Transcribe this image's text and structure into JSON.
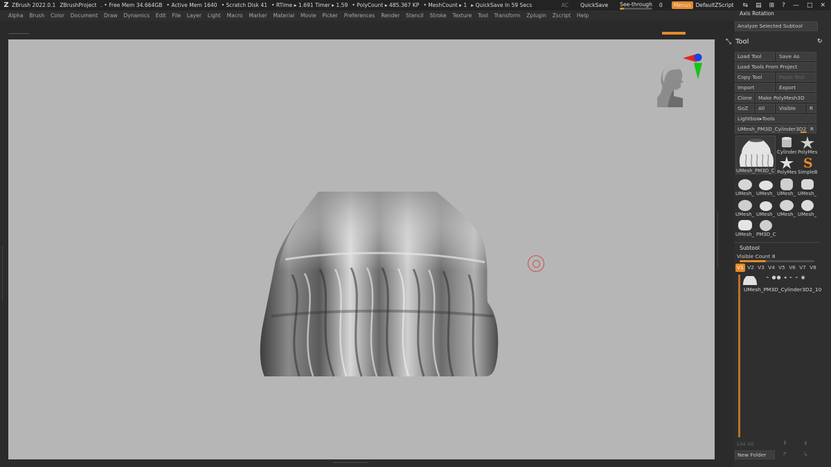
{
  "titlebar": {
    "app": "ZBrush 2022.0.1",
    "project": "ZBrushProject",
    "free_mem": ". • Free Mem 34.664GB",
    "active_mem": "• Active Mem 1640",
    "scratch_disk": "• Scratch Disk 41",
    "rtime": "• RTime ▸ 1.691 Timer ▸ 1.59",
    "polycount": "• PolyCount ▸ 485.367 KP",
    "meshcount": "• MeshCount ▸ 1",
    "quicksave_in": "▸ QuickSave In 59 Secs",
    "ac": "AC",
    "quicksave": "QuickSave",
    "see_through_label": "See-through",
    "see_through_value": "0",
    "see_through_level": 0.12,
    "menus": "Menus",
    "script": "DefaultZScript"
  },
  "menubar": [
    "Alpha",
    "Brush",
    "Color",
    "Document",
    "Draw",
    "Dynamics",
    "Edit",
    "File",
    "Layer",
    "Light",
    "Macro",
    "Marker",
    "Material",
    "Movie",
    "Picker",
    "Preferences",
    "Render",
    "Stencil",
    "Stroke",
    "Texture",
    "Tool",
    "Transform",
    "Zplugin",
    "Zscript",
    "Help"
  ],
  "rpanel": {
    "axis_rotation": "Axis Rotation",
    "analyze": "Analyze Selected Subtool",
    "tool_title": "Tool",
    "buttons": {
      "load_tool": "Load Tool",
      "save_as": "Save As",
      "load_from_project": "Load Tools From Project",
      "copy_tool": "Copy Tool",
      "paste_tool": "Paste Tool",
      "import": "Import",
      "export": "Export",
      "clone": "Clone",
      "make_polymesh": "Make PolyMesh3D",
      "goz": "GoZ",
      "all": "All",
      "visible": "Visible",
      "r": "R",
      "lightbox_tools": "Lightbox▸Tools",
      "current_tool": "UMesh_PM3D_Cylinder3D2_1",
      "current_tool_r": "R"
    },
    "thumbs": {
      "main": "UMesh_PM3D_C",
      "cylinder": "Cylinder",
      "polymesh_1": "PolyMes",
      "polymesh_2": "PolyMes",
      "simple": "SimpleB",
      "minis": [
        "UMesh_",
        "UMesh_",
        "UMesh_",
        "UMesh_",
        "UMesh_",
        "UMesh_",
        "UMesh_",
        "UMesh_",
        "UMesh_",
        "PM3D_C"
      ]
    },
    "subtool": {
      "title": "Subtool",
      "visible_count": "Visible Count 8",
      "visible_count_level": 0.35,
      "tabs": [
        "V1",
        "V2",
        "V3",
        "V4",
        "V5",
        "V6",
        "V7",
        "V8"
      ],
      "item_label": "UMesh_PM3D_Cylinder3D2_10",
      "list_all": "List All",
      "new_folder": "New Folder"
    }
  }
}
